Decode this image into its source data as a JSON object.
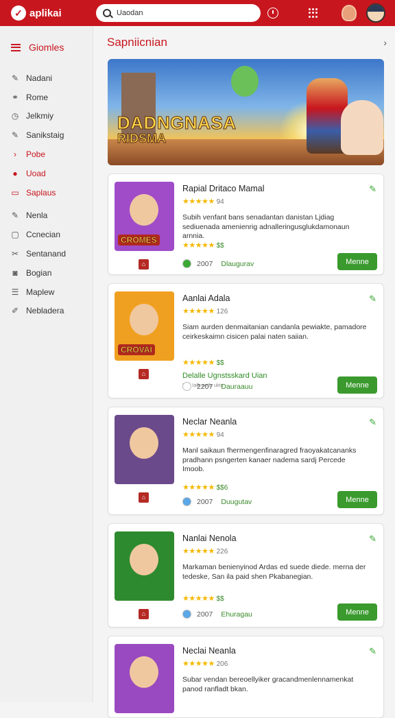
{
  "app": {
    "name": "aplikai",
    "logo_glyph": "✓"
  },
  "search": {
    "value": "Uaodan"
  },
  "sidebar": {
    "title": "Giomles",
    "items": [
      {
        "label": "Nadani",
        "icon": "pencil-icon",
        "glyph": "✎"
      },
      {
        "label": "Rome",
        "icon": "link-icon",
        "glyph": "⚭"
      },
      {
        "label": "Jelkmiy",
        "icon": "clock-icon",
        "glyph": "◷"
      },
      {
        "label": "Sanikstaig",
        "icon": "pencil-icon",
        "glyph": "✎"
      },
      {
        "label": "Pobe",
        "icon": "chevron-right-icon",
        "glyph": "›",
        "active": true
      },
      {
        "label": "Uoad",
        "icon": "pin-icon",
        "glyph": "●",
        "active": true
      },
      {
        "label": "Saplaus",
        "icon": "card-icon",
        "glyph": "▭",
        "active": true
      },
      {
        "label": "Nenla",
        "icon": "pencil-icon",
        "glyph": "✎"
      },
      {
        "label": "Ccnecian",
        "icon": "box-icon",
        "glyph": "▢"
      },
      {
        "label": "Sentanand",
        "icon": "wrench-icon",
        "glyph": "✂"
      },
      {
        "label": "Bogian",
        "icon": "camera-icon",
        "glyph": "◙"
      },
      {
        "label": "Maplew",
        "icon": "list-icon",
        "glyph": "☰"
      },
      {
        "label": "Nebladera",
        "icon": "tool-icon",
        "glyph": "✐"
      }
    ]
  },
  "main": {
    "section_title": "Sapniicnian",
    "banner": {
      "title": "DADNGNASA",
      "subtitle": "RIDSMA"
    },
    "cards": [
      {
        "title": "Rapial Dritaco Mamal",
        "rating": "94",
        "description": "Subih venfant bans senadantan danistan Ljdiag sediuenada amenienrig adnalleringusglukdamonaun arnnia.",
        "rating2": "$$",
        "link": "",
        "small": "",
        "meta_num": "2007",
        "meta_status": "Dlaugurav",
        "button": "Menne",
        "badge": "CROMES",
        "thumb_bg": "#a04cc8",
        "dot_color": "#3aa832"
      },
      {
        "title": "Aanlai Adala",
        "rating": "126",
        "description": "Siam aurden denmaitanian candanla pewiakte, pamadore ceirkeskaimn cisicen palai naten saiian.",
        "rating2": "$$",
        "link": "Delalle Ugnstsskard Uian",
        "small": "Fuli Ialk aetls ukts",
        "meta_num": "2207",
        "meta_status": "Dauraauu",
        "button": "Menne",
        "badge": "CROVAI",
        "thumb_bg": "#f0a020",
        "dot_color": "#ffffff"
      },
      {
        "title": "Neclar Neanla",
        "rating": "94",
        "description": "Manl saikaun fhermengenfinaragred fraoyakatcananks pradhann psngerten kanaer nadema sardj Percede Imoob.",
        "rating2": "$$6",
        "link": "",
        "small": "",
        "meta_num": "2007",
        "meta_status": "Duugutav",
        "button": "Menne",
        "badge": "",
        "thumb_bg": "#6a4a8a",
        "dot_color": "#5aa8e8"
      },
      {
        "title": "Nanlai Nenola",
        "rating": "226",
        "description": "Markaman benienyinod Ardas ed suede diede. merna der tedeske, San ila paid shen Pkabanegian.",
        "rating2": "$$",
        "link": "",
        "small": "",
        "meta_num": "2007",
        "meta_status": "Ehuragau",
        "button": "Menne",
        "badge": "",
        "thumb_bg": "#2e8a2e",
        "dot_color": "#5aa8e8"
      },
      {
        "title": "Neclai Neanla",
        "rating": "206",
        "description": "Subar vendan bereoellyiker gracandmenlennamenkat panod ranfladt bkan.",
        "rating2": "",
        "link": "",
        "small": "",
        "meta_num": "",
        "meta_status": "",
        "button": "",
        "badge": "",
        "thumb_bg": "#9a4ac0",
        "dot_color": "#5aa8e8"
      }
    ]
  },
  "colors": {
    "brand": "#c8161e",
    "accent_green": "#3a9a2e",
    "star": "#f5b800"
  }
}
